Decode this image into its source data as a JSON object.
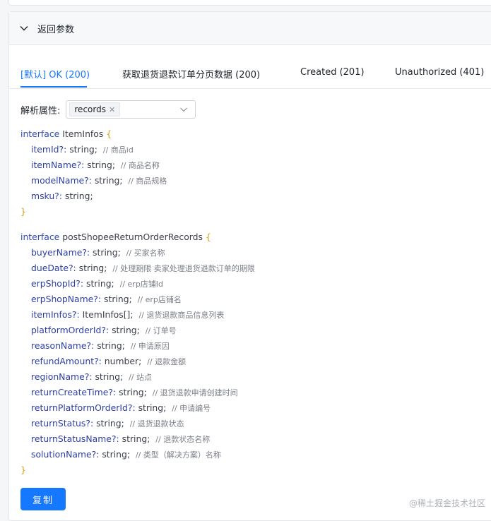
{
  "panel": {
    "title": "返回参数"
  },
  "tabs": [
    {
      "label": "[默认] OK (200)",
      "active": true
    },
    {
      "label": "获取退货退款订单分页数据 (200)",
      "active": false
    },
    {
      "label": "Created (201)",
      "active": false
    },
    {
      "label": "Unauthorized (401)",
      "active": false
    }
  ],
  "parse": {
    "label": "解析属性:",
    "selected_tag": "records"
  },
  "code": {
    "iface1": {
      "keyword": "interface",
      "name": "ItemInfos",
      "open": "{",
      "close": "}",
      "fields": [
        {
          "name": "itemId?:",
          "type": "string;",
          "comment": "// 商品id"
        },
        {
          "name": "itemName?:",
          "type": "string;",
          "comment": "// 商品名称"
        },
        {
          "name": "modelName?:",
          "type": "string;",
          "comment": "// 商品规格"
        },
        {
          "name": "msku?:",
          "type": "string;",
          "comment": ""
        }
      ]
    },
    "iface2": {
      "keyword": "interface",
      "name": "postShopeeReturnOrderRecords",
      "open": "{",
      "close": "}",
      "fields": [
        {
          "name": "buyerName?:",
          "type": "string;",
          "comment": "// 买家名称"
        },
        {
          "name": "dueDate?:",
          "type": "string;",
          "comment": "// 处理期限 卖家处理退货退款订单的期限"
        },
        {
          "name": "erpShopId?:",
          "type": "string;",
          "comment": "// erp店铺Id"
        },
        {
          "name": "erpShopName?:",
          "type": "string;",
          "comment": "// erp店铺名"
        },
        {
          "name": "itemInfos?:",
          "type": "ItemInfos[];",
          "comment": "// 退货退款商品信息列表"
        },
        {
          "name": "platformOrderId?:",
          "type": "string;",
          "comment": "// 订单号"
        },
        {
          "name": "reasonName?:",
          "type": "string;",
          "comment": "// 申请原因"
        },
        {
          "name": "refundAmount?:",
          "type": "number;",
          "comment": "// 退款金额"
        },
        {
          "name": "regionName?:",
          "type": "string;",
          "comment": "// 站点"
        },
        {
          "name": "returnCreateTime?:",
          "type": "string;",
          "comment": "// 退货退款申请创建时间"
        },
        {
          "name": "returnPlatformOrderId?:",
          "type": "string;",
          "comment": "// 申请编号"
        },
        {
          "name": "returnStatus?:",
          "type": "string;",
          "comment": "// 退货退款状态"
        },
        {
          "name": "returnStatusName?:",
          "type": "string;",
          "comment": "// 退款状态名称"
        },
        {
          "name": "solutionName?:",
          "type": "string;",
          "comment": "// 类型（解决方案）名称"
        }
      ]
    }
  },
  "copy_button": "复制",
  "watermark": "@稀土掘金技术社区",
  "colors": {
    "accent": "#1677ff"
  }
}
